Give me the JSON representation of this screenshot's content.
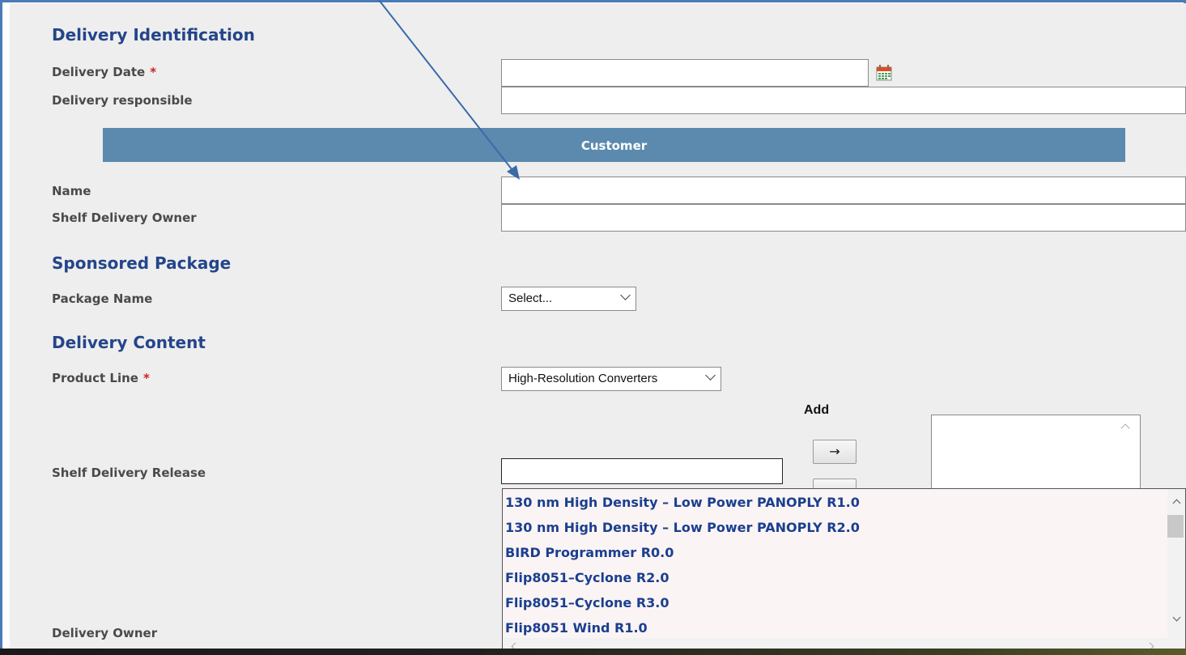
{
  "delivery_identification": {
    "title": "Delivery Identification",
    "delivery_date_label": "Delivery Date",
    "delivery_date_value": "",
    "delivery_responsible_label": "Delivery responsible",
    "delivery_responsible_value": "",
    "required_marker": "*",
    "calendar_icon": "calendar-icon"
  },
  "customer": {
    "header": "Customer",
    "name_label": "Name",
    "name_value": "",
    "shelf_delivery_owner_label": "Shelf Delivery Owner",
    "shelf_delivery_owner_value": ""
  },
  "sponsored_package": {
    "title": "Sponsored Package",
    "package_name_label": "Package Name",
    "package_name_selected": "Select..."
  },
  "delivery_content": {
    "title": "Delivery Content",
    "product_line_label": "Product Line",
    "product_line_selected": "High-Resolution Converters",
    "add_label": "Add",
    "add_button_symbol": "→",
    "shelf_delivery_release_label": "Shelf Delivery Release",
    "shelf_delivery_release_value": "",
    "delivery_owner_label": "Delivery Owner",
    "release_options": [
      "130 nm High Density – Low Power PANOPLY R1.0",
      "130 nm High Density – Low Power PANOPLY R2.0",
      "BIRD Programmer R0.0",
      "Flip8051–Cyclone R2.0",
      "Flip8051–Cyclone R3.0",
      "Flip8051 Wind R1.0"
    ]
  },
  "colors": {
    "section_title": "#24458a",
    "customer_bar": "#5b8aae",
    "required": "#cc2222",
    "frame_border": "#4a7ab8",
    "option_text": "#1a3f8f"
  }
}
